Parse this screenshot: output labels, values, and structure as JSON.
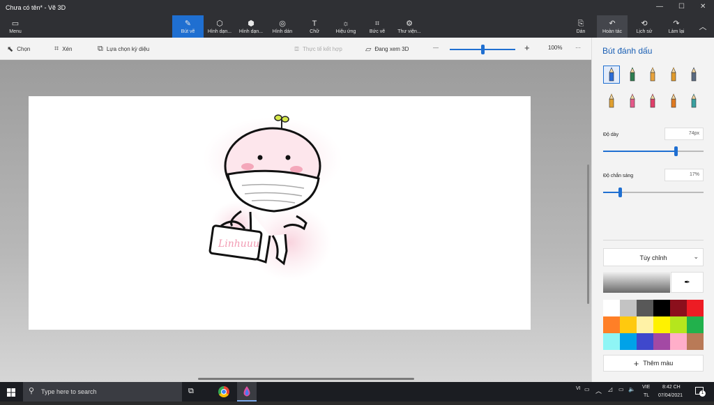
{
  "window": {
    "title": "Chưa có tên* - Vẽ 3D",
    "controls": {
      "minimize": "—",
      "maximize": "☐",
      "close": "✕"
    }
  },
  "ribbon": {
    "menu_label": "Menu",
    "tools": [
      {
        "label": "Bút vẽ",
        "icon": "brush-icon",
        "glyph": "✎",
        "active": true
      },
      {
        "label": "Hình dạn...",
        "icon": "2d-shapes-icon",
        "glyph": "⬡"
      },
      {
        "label": "Hình dạn...",
        "icon": "3d-shapes-icon",
        "glyph": "⬢"
      },
      {
        "label": "Hình dán",
        "icon": "stickers-icon",
        "glyph": "◎"
      },
      {
        "label": "Chữ",
        "icon": "text-icon",
        "glyph": "T"
      },
      {
        "label": "Hiệu ứng",
        "icon": "effects-icon",
        "glyph": "☼"
      },
      {
        "label": "Bức vẽ",
        "icon": "canvas-icon",
        "glyph": "⌗"
      },
      {
        "label": "Thư viện...",
        "icon": "library-icon",
        "glyph": "⚙"
      }
    ],
    "right": [
      {
        "label": "Dán",
        "icon": "paste-icon",
        "glyph": "📋"
      },
      {
        "label": "Hoàn tác",
        "icon": "undo-icon",
        "glyph": "↶"
      },
      {
        "label": "Lịch sử",
        "icon": "history-icon",
        "glyph": "⟲"
      },
      {
        "label": "Làm lại",
        "icon": "redo-icon",
        "glyph": "↷"
      }
    ],
    "collapse_glyph": "︿"
  },
  "toolbar": {
    "select_label": "Chọn",
    "crop_label": "Xén",
    "magic_select_label": "Lựa chọn kỳ diệu",
    "mixed_reality_label": "Thực tế kết hợp",
    "view3d_label": "Đang xem 3D",
    "zoom_minus": "—",
    "zoom_plus": "+",
    "zoom_percent": "100%",
    "zoom_value": 0.5,
    "more": "···"
  },
  "canvas": {
    "signature_text": "Linhuuu"
  },
  "panel": {
    "title": "Bút đánh dấu",
    "brushes": [
      {
        "name": "marker",
        "color": "#2a6bd6",
        "selected": true
      },
      {
        "name": "calligraphy-pen",
        "color": "#2e7d4f"
      },
      {
        "name": "oil-brush",
        "color": "#e8a33c"
      },
      {
        "name": "watercolor",
        "color": "#e09a2a"
      },
      {
        "name": "pixel-pen",
        "color": "#5a6a80"
      },
      {
        "name": "pencil",
        "color": "#e0a030"
      },
      {
        "name": "eraser",
        "color": "#e55a8a"
      },
      {
        "name": "crayon",
        "color": "#e0406a"
      },
      {
        "name": "spray-can",
        "color": "#e07a20"
      },
      {
        "name": "fill",
        "color": "#3aa0a0"
      }
    ],
    "thickness_label": "Độ dày",
    "thickness_value": "74px",
    "thickness_level": 0.72,
    "opacity_label": "Độ chắn sáng",
    "opacity_value": "17%",
    "opacity_level": 0.17,
    "color_mode": "Tùy chỉnh",
    "palette": [
      "#ffffff",
      "#c3c3c3",
      "#585858",
      "#000000",
      "#8b0f1c",
      "#ed1c24",
      "#ff7f27",
      "#ffc90e",
      "#fff2a6",
      "#fff200",
      "#b5e61d",
      "#22b14c",
      "#8ff5f5",
      "#00a2e8",
      "#3f48cc",
      "#a349a4",
      "#ffaec9",
      "#b97a57"
    ],
    "add_color_label": "Thêm màu"
  },
  "taskbar": {
    "search_placeholder": "Type here to search",
    "lang": "VIE",
    "lang_sub": "TL",
    "time": "8:42 CH",
    "date": "07/04/2021",
    "tray_vi": "VI",
    "notification_count": "1"
  }
}
